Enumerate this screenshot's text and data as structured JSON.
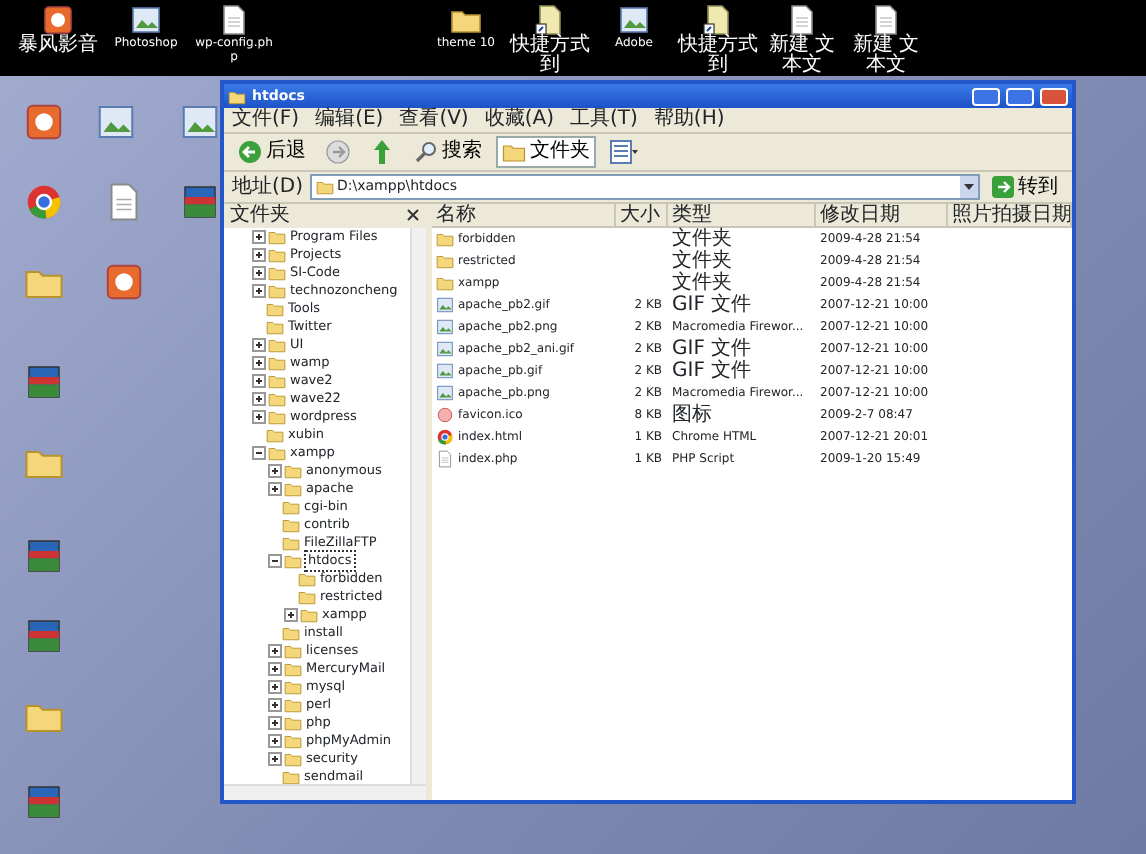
{
  "desktop_top_icons": [
    {
      "label": "暴风影音",
      "kind": "app"
    },
    {
      "label": "Photoshop",
      "kind": "image"
    },
    {
      "label": "wp-config.php",
      "kind": "file"
    },
    {
      "label": "theme 10",
      "kind": "folder"
    },
    {
      "label": "快捷方式到",
      "kind": "shortcut"
    },
    {
      "label": "Adobe",
      "kind": "image"
    },
    {
      "label": "快捷方式到",
      "kind": "shortcut"
    },
    {
      "label": "新建 文本文",
      "kind": "file"
    },
    {
      "label": "新建 文本文",
      "kind": "file"
    }
  ],
  "desktop_left_icons": [
    {
      "kind": "app"
    },
    {
      "kind": "image"
    },
    {
      "kind": "image"
    },
    {
      "kind": "chrome"
    },
    {
      "kind": "file"
    },
    {
      "kind": "archive"
    },
    {
      "kind": "folder"
    },
    {
      "kind": "app"
    },
    {
      "kind": "archive"
    },
    {
      "kind": "folder"
    },
    {
      "kind": "archive"
    },
    {
      "kind": "archive"
    },
    {
      "kind": "folder"
    },
    {
      "kind": "archive"
    }
  ],
  "window": {
    "title": "htdocs",
    "menu": [
      "文件(F)",
      "编辑(E)",
      "查看(V)",
      "收藏(A)",
      "工具(T)",
      "帮助(H)"
    ],
    "toolbar": {
      "back": "后退",
      "search": "搜索",
      "folders": "文件夹"
    },
    "address": {
      "label": "地址(D)",
      "value": "D:\\xampp\\htdocs",
      "go": "转到"
    },
    "tree": {
      "title": "文件夹",
      "items": [
        {
          "label": "Program Files",
          "expandable": true,
          "expanded": false,
          "selected": false
        },
        {
          "label": "Projects",
          "expandable": true,
          "expanded": false,
          "selected": false
        },
        {
          "label": "SI-Code",
          "expandable": true,
          "expanded": false,
          "selected": false
        },
        {
          "label": "technozoncheng",
          "expandable": true,
          "expanded": false,
          "selected": false
        },
        {
          "label": "Tools",
          "expandable": false,
          "selected": false
        },
        {
          "label": "Twitter",
          "expandable": false,
          "selected": false
        },
        {
          "label": "UI",
          "expandable": true,
          "expanded": false,
          "selected": false
        },
        {
          "label": "wamp",
          "expandable": true,
          "expanded": false,
          "selected": false
        },
        {
          "label": "wave2",
          "expandable": true,
          "expanded": false,
          "selected": false
        },
        {
          "label": "wave22",
          "expandable": true,
          "expanded": false,
          "selected": false
        },
        {
          "label": "wordpress",
          "expandable": true,
          "expanded": false,
          "selected": false
        },
        {
          "label": "xubin",
          "expandable": false,
          "selected": false
        },
        {
          "label": "xampp",
          "expandable": true,
          "expanded": true,
          "selected": false,
          "children": [
            {
              "label": "anonymous",
              "expandable": true,
              "expanded": false,
              "selected": false
            },
            {
              "label": "apache",
              "expandable": true,
              "expanded": false,
              "selected": false
            },
            {
              "label": "cgi-bin",
              "expandable": false,
              "selected": false
            },
            {
              "label": "contrib",
              "expandable": false,
              "selected": false
            },
            {
              "label": "FileZillaFTP",
              "expandable": false,
              "selected": false
            },
            {
              "label": "htdocs",
              "expandable": true,
              "expanded": true,
              "selected": true,
              "children": [
                {
                  "label": "forbidden",
                  "expandable": false,
                  "selected": false
                },
                {
                  "label": "restricted",
                  "expandable": false,
                  "selected": false
                },
                {
                  "label": "xampp",
                  "expandable": true,
                  "expanded": false,
                  "selected": false
                }
              ]
            },
            {
              "label": "install",
              "expandable": false,
              "selected": false
            },
            {
              "label": "licenses",
              "expandable": true,
              "expanded": false,
              "selected": false
            },
            {
              "label": "MercuryMail",
              "expandable": true,
              "expanded": false,
              "selected": false
            },
            {
              "label": "mysql",
              "expandable": true,
              "expanded": false,
              "selected": false
            },
            {
              "label": "perl",
              "expandable": true,
              "expanded": false,
              "selected": false
            },
            {
              "label": "php",
              "expandable": true,
              "expanded": false,
              "selected": false
            },
            {
              "label": "phpMyAdmin",
              "expandable": true,
              "expanded": false,
              "selected": false
            },
            {
              "label": "security",
              "expandable": true,
              "expanded": false,
              "selected": false
            },
            {
              "label": "sendmail",
              "expandable": false,
              "selected": false
            }
          ]
        }
      ]
    },
    "list": {
      "columns": [
        "名称",
        "大小",
        "类型",
        "修改日期",
        "照片拍摄日期"
      ],
      "rows": [
        {
          "kind": "folder",
          "name": "forbidden",
          "size": "",
          "type": "文件夹",
          "modified": "2009-4-28 21:54"
        },
        {
          "kind": "folder",
          "name": "restricted",
          "size": "",
          "type": "文件夹",
          "modified": "2009-4-28 21:54"
        },
        {
          "kind": "folder",
          "name": "xampp",
          "size": "",
          "type": "文件夹",
          "modified": "2009-4-28 21:54"
        },
        {
          "kind": "image",
          "name": "apache_pb2.gif",
          "size": "2 KB",
          "type": "GIF 文件",
          "modified": "2007-12-21 10:00"
        },
        {
          "kind": "image",
          "name": "apache_pb2.png",
          "size": "2 KB",
          "type": "Macromedia Firewor...",
          "modified": "2007-12-21 10:00"
        },
        {
          "kind": "image",
          "name": "apache_pb2_ani.gif",
          "size": "2 KB",
          "type": "GIF 文件",
          "modified": "2007-12-21 10:00"
        },
        {
          "kind": "image",
          "name": "apache_pb.gif",
          "size": "2 KB",
          "type": "GIF 文件",
          "modified": "2007-12-21 10:00"
        },
        {
          "kind": "image",
          "name": "apache_pb.png",
          "size": "2 KB",
          "type": "Macromedia Firewor...",
          "modified": "2007-12-21 10:00"
        },
        {
          "kind": "icon",
          "name": "favicon.ico",
          "size": "8 KB",
          "type": "图标",
          "modified": "2009-2-7 08:47"
        },
        {
          "kind": "chrome",
          "name": "index.html",
          "size": "1 KB",
          "type": "Chrome HTML",
          "modified": "2007-12-21 20:01"
        },
        {
          "kind": "file",
          "name": "index.php",
          "size": "1 KB",
          "type": "PHP Script",
          "modified": "2009-1-20 15:49"
        }
      ]
    }
  }
}
